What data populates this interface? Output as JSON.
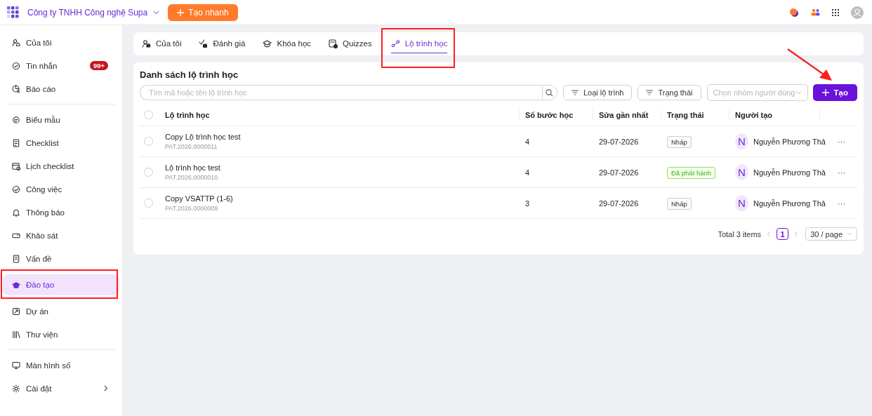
{
  "topbar": {
    "company": "Công ty TNHH Công nghệ Supa",
    "quick_create": "Tạo nhanh"
  },
  "sidebar": {
    "groups": [
      [
        {
          "label": "Của tôi",
          "selected": false,
          "annotated": false,
          "kind": "link"
        },
        {
          "label": "Tin nhắn",
          "selected": false,
          "annotated": false,
          "kind": "link",
          "badge": "99+"
        },
        {
          "label": "Báo cáo",
          "selected": false,
          "annotated": false,
          "kind": "link"
        }
      ],
      [
        {
          "label": "Biểu mẫu",
          "selected": false,
          "annotated": false,
          "kind": "link"
        },
        {
          "label": "Checklist",
          "selected": false,
          "annotated": false,
          "kind": "link"
        },
        {
          "label": "Lịch checklist",
          "selected": false,
          "annotated": false,
          "kind": "link"
        },
        {
          "label": "Công việc",
          "selected": false,
          "annotated": false,
          "kind": "link"
        },
        {
          "label": "Thông báo",
          "selected": false,
          "annotated": false,
          "kind": "link"
        },
        {
          "label": "Khảo sát",
          "selected": false,
          "annotated": false,
          "kind": "link"
        },
        {
          "label": "Vấn đề",
          "selected": false,
          "annotated": false,
          "kind": "link"
        },
        {
          "label": "Đào tạo",
          "selected": true,
          "annotated": true,
          "kind": "link"
        },
        {
          "label": "Dự án",
          "selected": false,
          "annotated": false,
          "kind": "link"
        },
        {
          "label": "Thư viện",
          "selected": false,
          "annotated": false,
          "kind": "link"
        }
      ],
      [
        {
          "label": "Màn hình số",
          "selected": false,
          "annotated": false,
          "kind": "link"
        },
        {
          "label": "Cài đặt",
          "selected": false,
          "annotated": false,
          "kind": "submenu"
        }
      ]
    ]
  },
  "tabs": [
    {
      "label": "Của tôi",
      "selected": false,
      "annotated": false
    },
    {
      "label": "Đánh giá",
      "selected": false,
      "annotated": false
    },
    {
      "label": "Khóa học",
      "selected": false,
      "annotated": false
    },
    {
      "label": "Quizzes",
      "selected": false,
      "annotated": false
    },
    {
      "label": "Lộ trình học",
      "selected": true,
      "annotated": true
    }
  ],
  "list": {
    "title": "Danh sách lộ trình học",
    "search": {
      "placeholder": "Tìm mã hoặc tên lộ trình học"
    },
    "filters": [
      "Loại lộ trình",
      "Trạng thái"
    ],
    "group_select": {
      "placeholder": "Chọn nhóm người dùng"
    },
    "create_button": {
      "label": "Tạo",
      "annotated": true
    },
    "columns": [
      "Lộ trình học",
      "Số bước học",
      "Sửa gần nhất",
      "Trạng thái",
      "Người tạo"
    ],
    "select_all": false,
    "rows": [
      {
        "name": "Copy Lộ trình học test",
        "code": "PAT.2026.0000011",
        "steps": "4",
        "updated": "29-07-2026",
        "status": {
          "label": "Nháp",
          "kind": "draft"
        },
        "creator_initial": "N",
        "creator": "Nguyễn Phương Thả",
        "actions": "···",
        "selected": false
      },
      {
        "name": "Lộ trình học test",
        "code": "PAT.2026.0000010",
        "steps": "4",
        "updated": "29-07-2026",
        "status": {
          "label": "Đã phát hành",
          "kind": "published"
        },
        "creator_initial": "N",
        "creator": "Nguyễn Phương Thả",
        "actions": "···",
        "selected": false
      },
      {
        "name": "Copy VSATTP (1-6)",
        "code": "PAT.2026.0000009",
        "steps": "3",
        "updated": "29-07-2026",
        "status": {
          "label": "Nháp",
          "kind": "draft"
        },
        "creator_initial": "N",
        "creator": "Nguyễn Phương Thả",
        "actions": "···",
        "selected": false
      }
    ],
    "pagination": {
      "total": "Total 3 items",
      "pages": [
        {
          "label": "1",
          "selected": true
        }
      ],
      "page_size": "30 / page"
    }
  }
}
